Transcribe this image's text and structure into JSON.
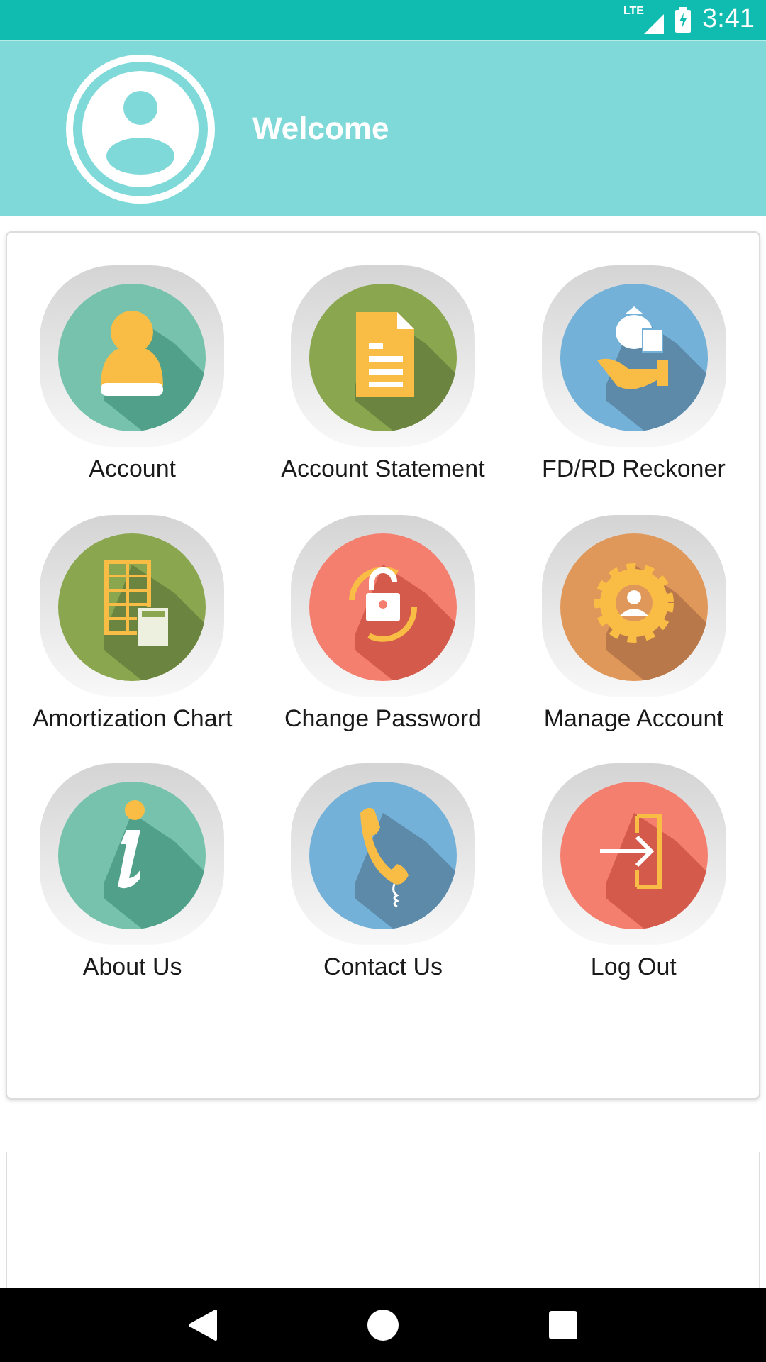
{
  "status_bar": {
    "network": "LTE",
    "time": "3:41"
  },
  "header": {
    "title": "Welcome"
  },
  "menu": [
    {
      "label": "Account",
      "kind": "person"
    },
    {
      "label": "Account Statement",
      "kind": "document"
    },
    {
      "label": "FD/RD Reckoner",
      "kind": "money"
    },
    {
      "label": "Amortization Chart",
      "kind": "table"
    },
    {
      "label": "Change Password",
      "kind": "lock"
    },
    {
      "label": "Manage Account",
      "kind": "gear"
    },
    {
      "label": "About Us",
      "kind": "info"
    },
    {
      "label": "Contact Us",
      "kind": "phone"
    },
    {
      "label": "Log Out",
      "kind": "exit"
    }
  ]
}
